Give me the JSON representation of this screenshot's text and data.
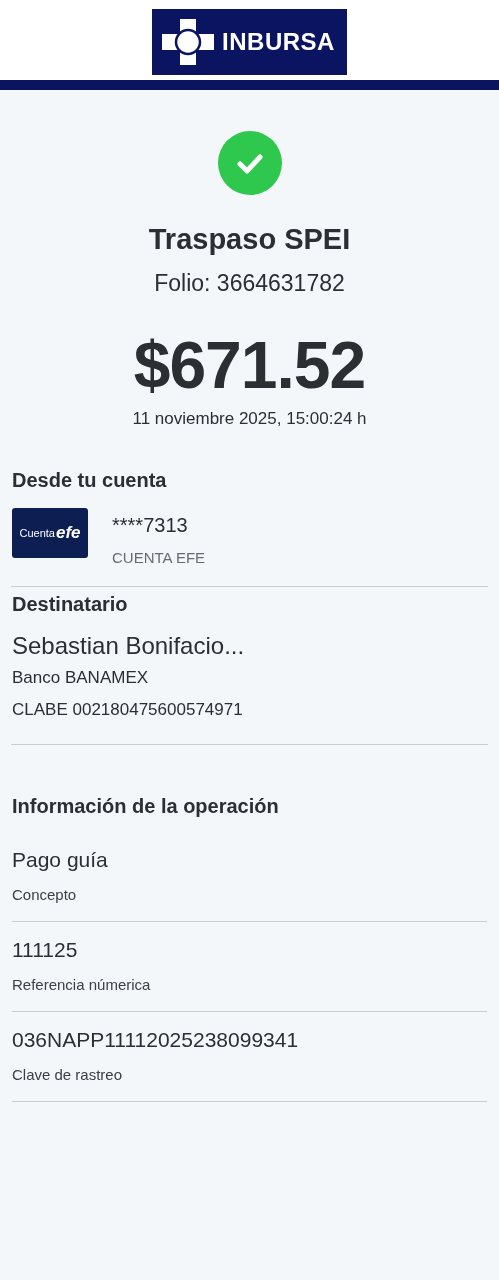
{
  "header": {
    "brand": "INBURSA"
  },
  "status": {
    "kind": "success"
  },
  "title": "Traspaso SPEI",
  "folio": "Folio: 3664631782",
  "amount": "$671.52",
  "datetime": "11 noviembre 2025, 15:00:24 h",
  "origin": {
    "heading": "Desde tu cuenta",
    "card_logo": {
      "prefix": "Cuenta",
      "brand": "efe"
    },
    "account": "****7313",
    "account_type": "CUENTA EFE"
  },
  "recipient": {
    "heading": "Destinatario",
    "name": "Sebastian Bonifacio...",
    "bank": "Banco BANAMEX",
    "clabe": "CLABE 002180475600574971"
  },
  "operation": {
    "heading": "Información de la operación",
    "items": [
      {
        "value": "Pago guía",
        "label": "Concepto"
      },
      {
        "value": "111125",
        "label": "Referencia númerica"
      },
      {
        "value": "036NAPP11112025238099341",
        "label": "Clave de rastreo"
      }
    ]
  }
}
